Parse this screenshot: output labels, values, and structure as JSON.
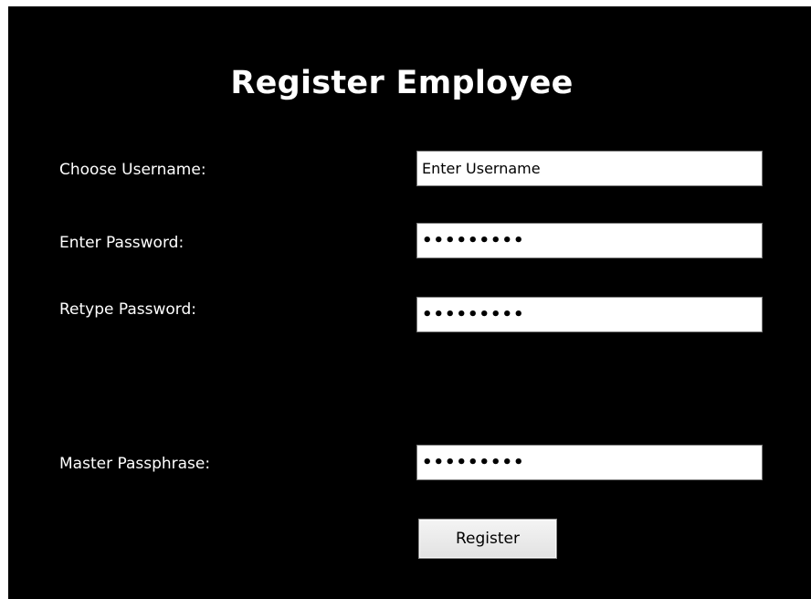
{
  "form": {
    "title": "Register Employee",
    "fields": [
      {
        "label": "Choose Username:",
        "value": "Enter Username",
        "type": "text"
      },
      {
        "label": "Enter Password:",
        "value": "●●●●●●●●●",
        "type": "password"
      },
      {
        "label": "Retype Password:",
        "value": "●●●●●●●●●",
        "type": "password"
      },
      {
        "label": "Master Passphrase:",
        "value": "●●●●●●●●●",
        "type": "password"
      }
    ],
    "register_label": "Register"
  }
}
